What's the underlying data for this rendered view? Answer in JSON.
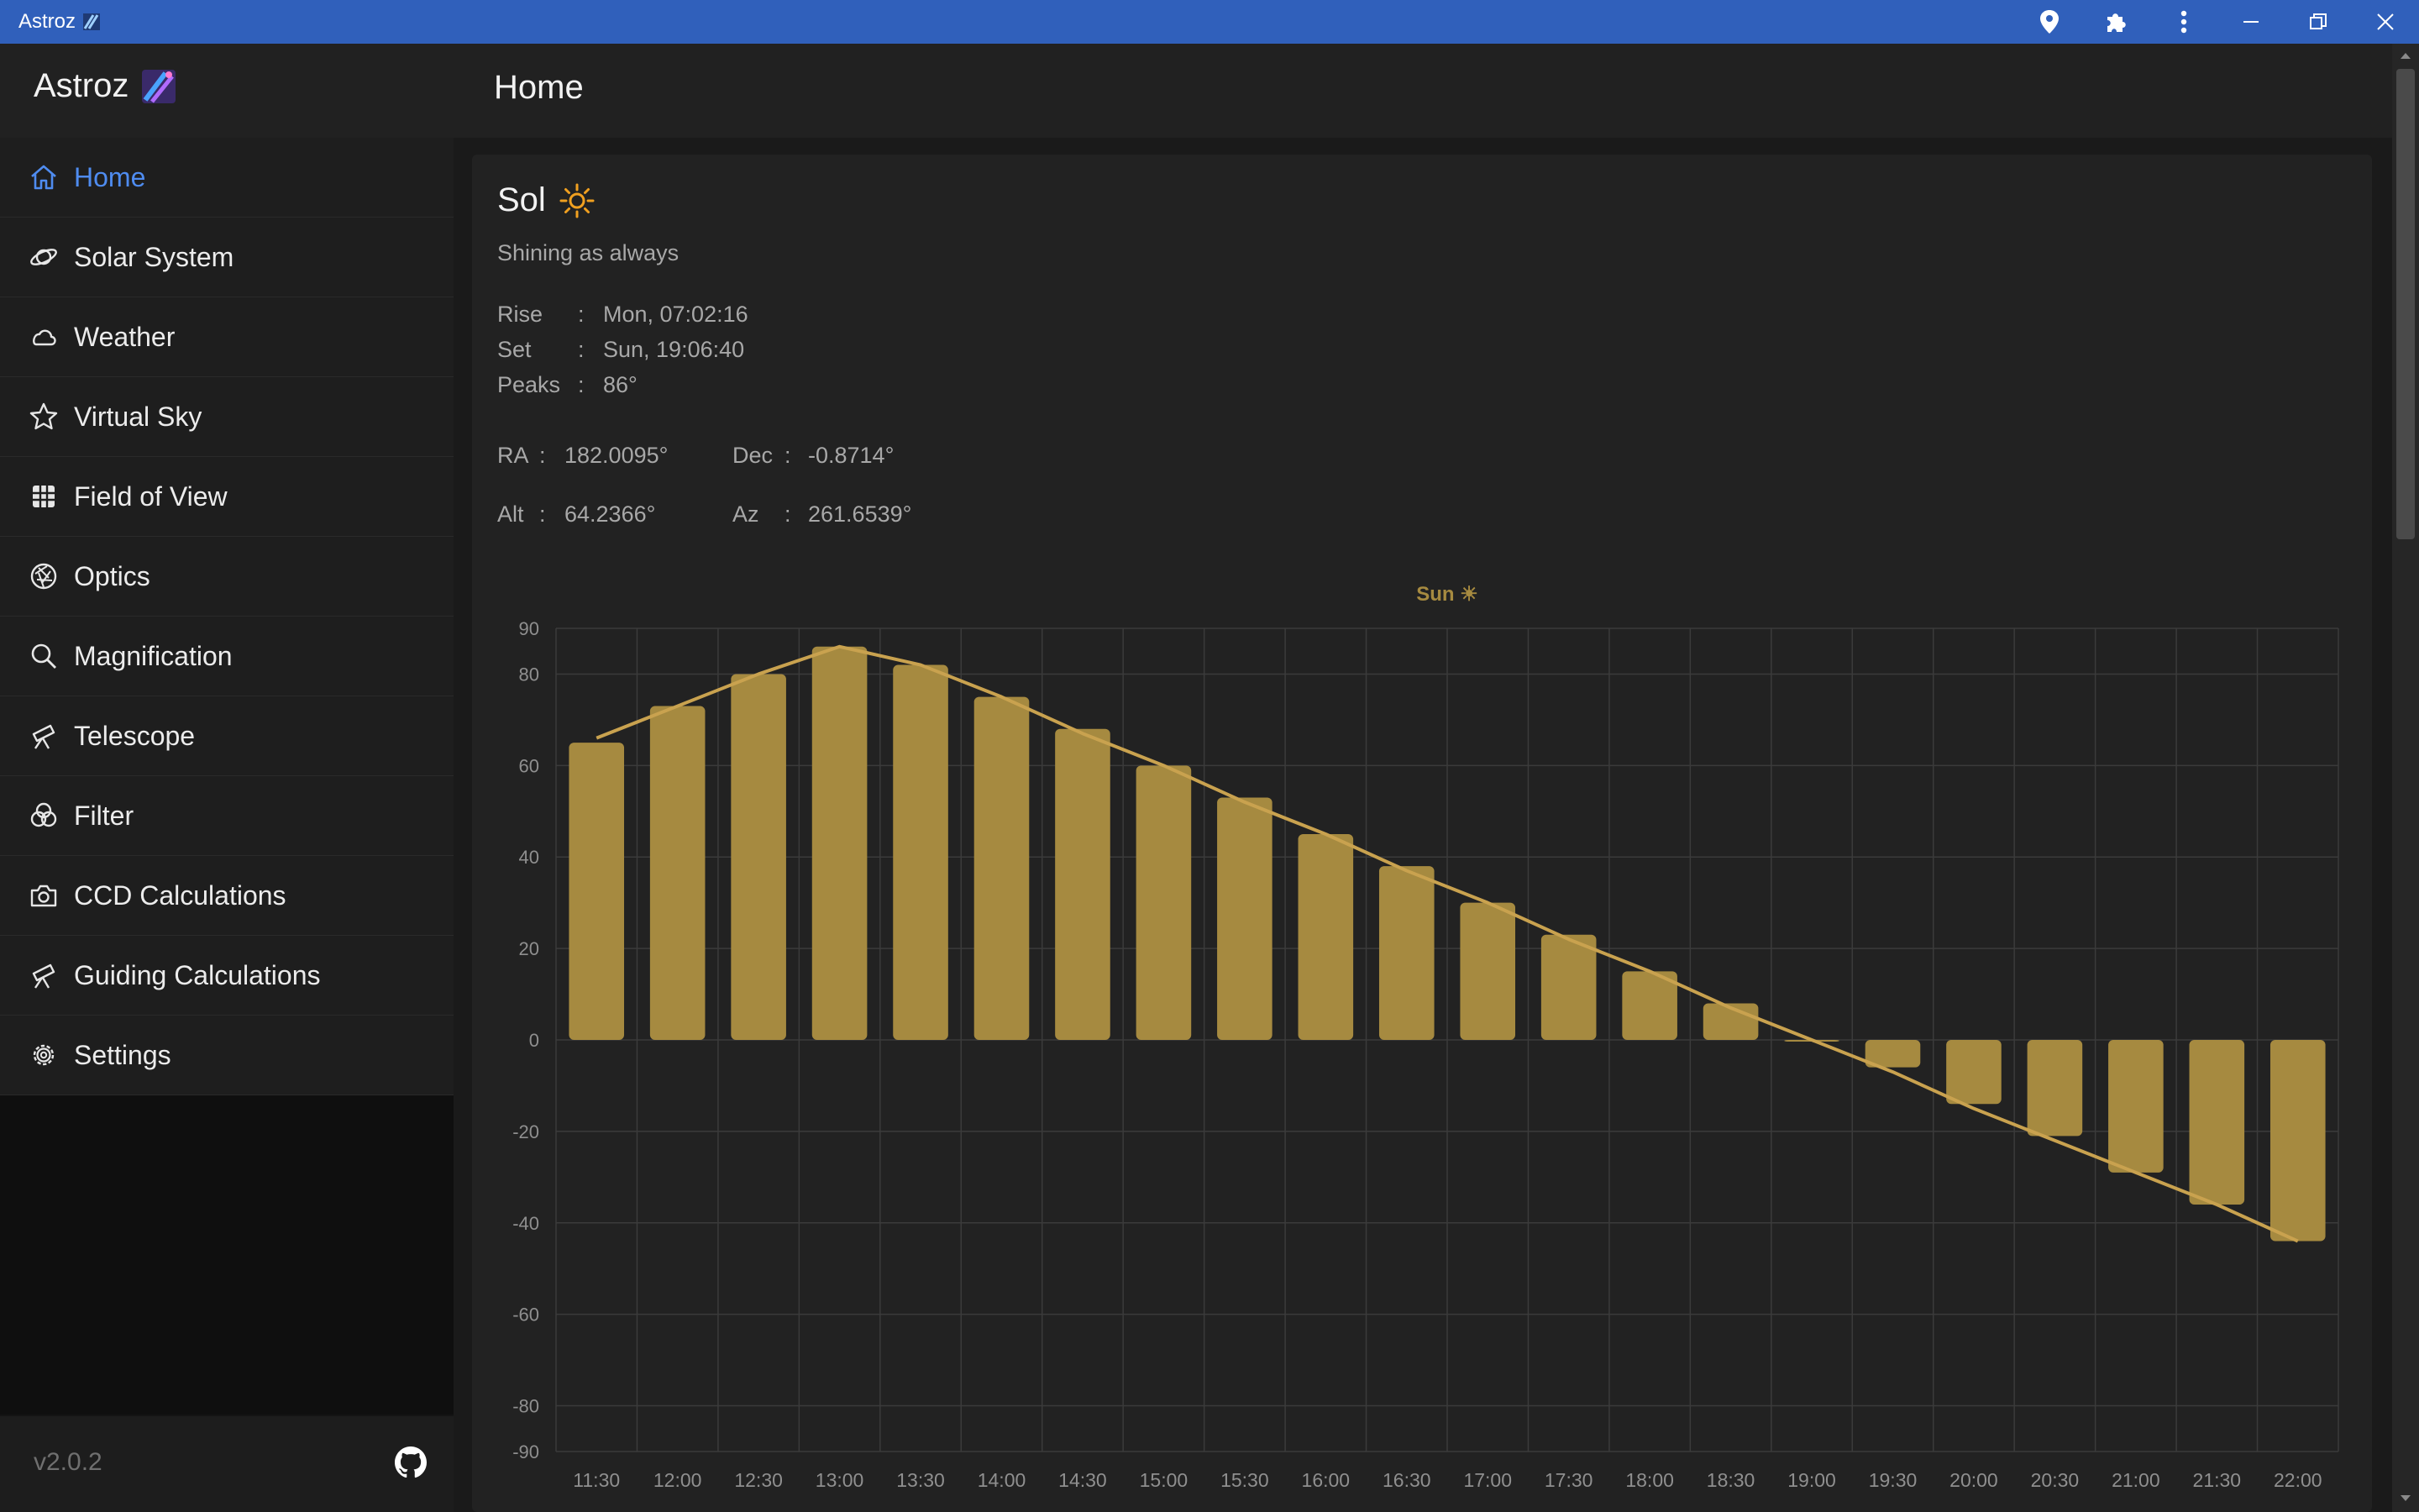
{
  "window": {
    "title": "Astroz",
    "controls": [
      "location-icon",
      "extensions-icon",
      "menu-dots-icon",
      "minimize-icon",
      "restore-icon",
      "close-icon"
    ]
  },
  "header": {
    "brand": "Astroz",
    "page_title": "Home"
  },
  "sidebar": {
    "items": [
      {
        "label": "Home",
        "icon": "home-icon",
        "active": true
      },
      {
        "label": "Solar System",
        "icon": "planet-icon",
        "active": false
      },
      {
        "label": "Weather",
        "icon": "cloud-icon",
        "active": false
      },
      {
        "label": "Virtual Sky",
        "icon": "star-icon",
        "active": false
      },
      {
        "label": "Field of View",
        "icon": "grid-icon",
        "active": false
      },
      {
        "label": "Optics",
        "icon": "aperture-icon",
        "active": false
      },
      {
        "label": "Magnification",
        "icon": "search-icon",
        "active": false
      },
      {
        "label": "Telescope",
        "icon": "telescope-icon",
        "active": false
      },
      {
        "label": "Filter",
        "icon": "filter-icon",
        "active": false
      },
      {
        "label": "CCD Calculations",
        "icon": "camera-icon",
        "active": false
      },
      {
        "label": "Guiding Calculations",
        "icon": "telescope-icon",
        "active": false
      },
      {
        "label": "Settings",
        "icon": "gear-icon",
        "active": false
      }
    ],
    "version": "v2.0.2",
    "footer_icon": "github-icon"
  },
  "sol": {
    "title": "Sol",
    "subtitle": "Shining as always",
    "rise_label": "Rise",
    "rise_value": "Mon, 07:02:16",
    "set_label": "Set",
    "set_value": "Sun, 19:06:40",
    "peaks_label": "Peaks",
    "peaks_value": "86°",
    "sep": ":",
    "ra_label": "RA",
    "ra_value": "182.0095°",
    "dec_label": "Dec",
    "dec_value": "-0.8714°",
    "alt_label": "Alt",
    "alt_value": "64.2366°",
    "az_label": "Az",
    "az_value": "261.6539°"
  },
  "colors": {
    "accent": "#4f8cf0",
    "bar": "#a68a40",
    "line": "#c9a24f",
    "titlebar": "#3060bb"
  },
  "chart_data": {
    "type": "bar",
    "title": "Sun ☀",
    "categories": [
      "11:30",
      "12:00",
      "12:30",
      "13:00",
      "13:30",
      "14:00",
      "14:30",
      "15:00",
      "15:30",
      "16:00",
      "16:30",
      "17:00",
      "17:30",
      "18:00",
      "18:30",
      "19:00",
      "19:30",
      "20:00",
      "20:30",
      "21:00",
      "21:30",
      "22:00"
    ],
    "series": [
      {
        "type": "bar",
        "values": [
          65,
          73,
          80,
          86,
          82,
          75,
          68,
          60,
          53,
          45,
          38,
          30,
          23,
          15,
          8,
          0,
          -6,
          -14,
          -21,
          -29,
          -36,
          -44
        ]
      },
      {
        "type": "line",
        "values": [
          66,
          73,
          80,
          86,
          82,
          75,
          67,
          60,
          52,
          45,
          37,
          30,
          22,
          15,
          7,
          0,
          -7,
          -15,
          -22,
          -29,
          -36,
          -44
        ]
      }
    ],
    "yticks": [
      90,
      80,
      60,
      40,
      20,
      0,
      -20,
      -40,
      -60,
      -80,
      -90
    ],
    "ylim": [
      -90,
      90
    ],
    "grid": true,
    "xlabel": "",
    "ylabel": ""
  }
}
